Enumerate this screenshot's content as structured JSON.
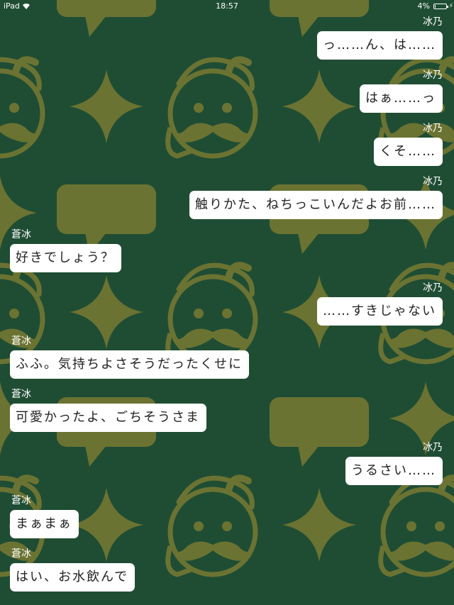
{
  "status_bar": {
    "device": "iPad",
    "time": "18:57",
    "battery_percent": "4%",
    "battery_level": 0.04,
    "wifi_icon": "wifi-icon",
    "battery_icon": "battery-icon",
    "charging_icon": "charging-bolt-icon"
  },
  "colors": {
    "background": "#1f4d34",
    "pattern": "#6b7332",
    "bubble": "#ffffff",
    "text": "#222222"
  },
  "messages": [
    {
      "side": "right",
      "sender": "冰乃",
      "text": "っ……ん、は……"
    },
    {
      "side": "right",
      "sender": "冰乃",
      "text": "はぁ……っ"
    },
    {
      "side": "right",
      "sender": "冰乃",
      "text": "くそ……"
    },
    {
      "side": "right",
      "sender": "冰乃",
      "text": "触りかた、ねちっこいんだよお前……"
    },
    {
      "side": "left",
      "sender": "蒼冰",
      "text": "好きでしょう？"
    },
    {
      "side": "right",
      "sender": "冰乃",
      "text": "……すきじゃない"
    },
    {
      "side": "left",
      "sender": "蒼冰",
      "text": "ふふ。気持ちよさそうだったくせに"
    },
    {
      "side": "left",
      "sender": "蒼冰",
      "text": "可愛かったよ、ごちそうさま"
    },
    {
      "side": "right",
      "sender": "冰乃",
      "text": "うるさい……"
    },
    {
      "side": "left",
      "sender": "蒼冰",
      "text": "まぁまぁ"
    },
    {
      "side": "left",
      "sender": "蒼冰",
      "text": "はい、お水飲んで"
    }
  ]
}
